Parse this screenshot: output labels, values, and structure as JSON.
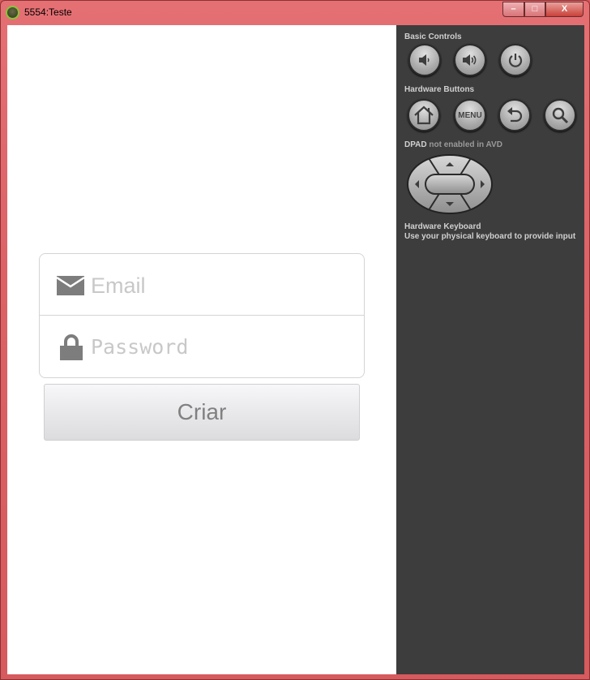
{
  "window": {
    "title": "5554:Teste",
    "minimize": "–",
    "maximize": "□",
    "close": "X"
  },
  "screen": {
    "email": {
      "placeholder": "Email",
      "icon": "envelope-icon"
    },
    "password": {
      "placeholder": "Password",
      "icon": "lock-icon"
    },
    "submit_label": "Criar"
  },
  "panel": {
    "basic_controls": "Basic Controls",
    "hardware_buttons": "Hardware Buttons",
    "menu_label": "MENU",
    "dpad": "DPAD",
    "dpad_note": "not enabled in AVD",
    "keyboard_title": "Hardware Keyboard",
    "keyboard_note": "Use your physical keyboard to provide input"
  },
  "colors": {
    "panel_bg": "#3d3d3d",
    "frame": "#dc6266"
  }
}
